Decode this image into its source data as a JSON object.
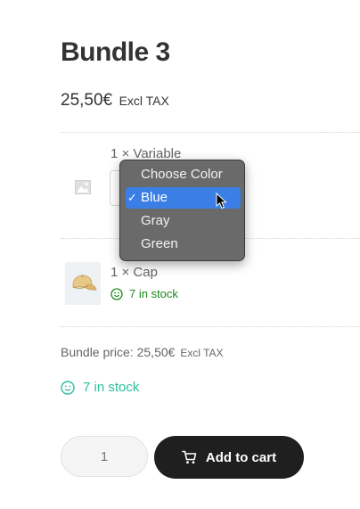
{
  "product": {
    "title": "Bundle 3",
    "price": "25,50€",
    "tax_label": "Excl TAX"
  },
  "bundle_items": [
    {
      "name": "1 × Variable",
      "select": {
        "options": [
          "Choose Color",
          "Blue",
          "Gray",
          "Green"
        ],
        "selected": "Blue",
        "check_glyph": "✓"
      }
    },
    {
      "name": "1 × Cap",
      "stock": "7 in stock",
      "thumb_icon": "cap-image"
    }
  ],
  "bundle_price": {
    "label": "Bundle price: 25,50€",
    "tax_label": "Excl TAX"
  },
  "stock": {
    "text": "7 in stock",
    "icon": "smile-icon"
  },
  "cart": {
    "quantity": "1",
    "button_label": "Add to cart",
    "icon": "cart-icon"
  },
  "colors": {
    "text": "#333333",
    "stock_green": "#1a8a1a",
    "stock_teal": "#2abf9e",
    "button_bg": "#1f1f1f",
    "dropdown_selected": "#3a7ee6"
  }
}
